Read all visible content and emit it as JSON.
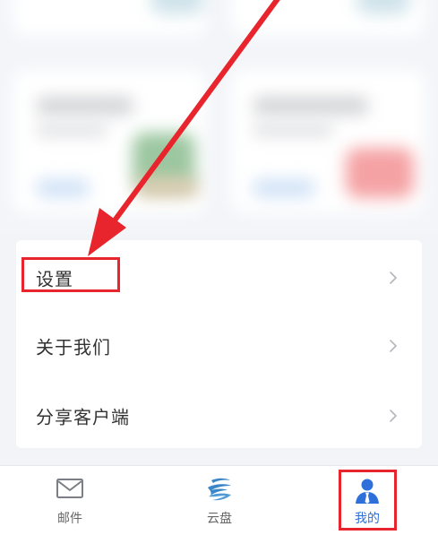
{
  "menu": {
    "items": [
      {
        "label": "设置"
      },
      {
        "label": "关于我们"
      },
      {
        "label": "分享客户端"
      }
    ]
  },
  "tab_bar": {
    "tabs": [
      {
        "label": "邮件",
        "icon": "mail-icon",
        "active": false
      },
      {
        "label": "云盘",
        "icon": "cloud-disk-icon",
        "active": false
      },
      {
        "label": "我的",
        "icon": "user-profile-icon",
        "active": true
      }
    ]
  },
  "colors": {
    "accent_blue": "#2e6fd9",
    "annotation_red": "#e8242d",
    "page_background": "#f2f4f8",
    "text_primary": "#333333",
    "text_secondary": "#666666"
  }
}
